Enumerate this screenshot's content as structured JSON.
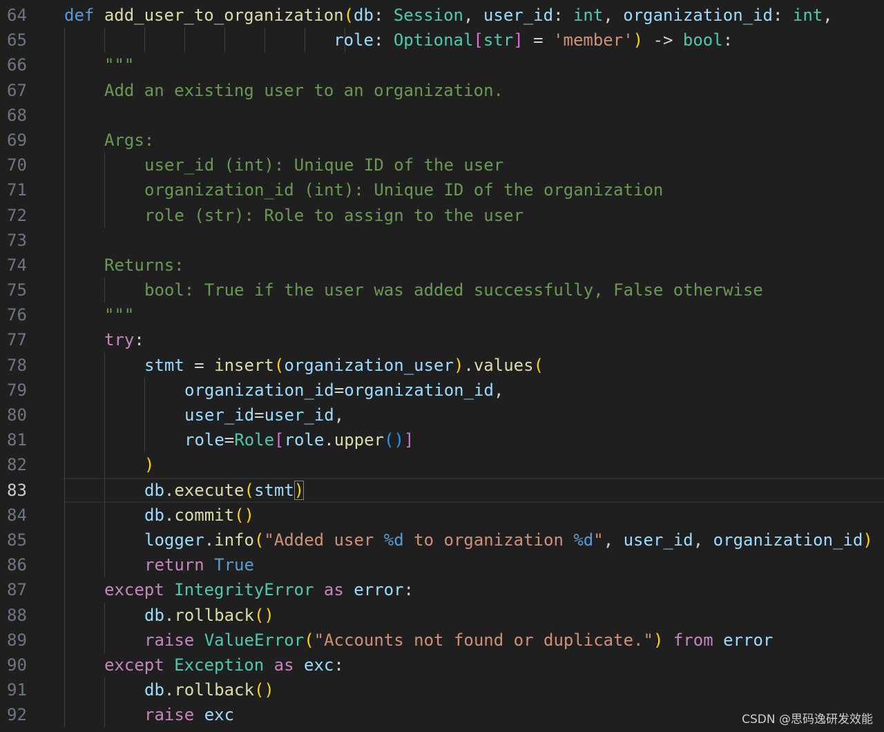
{
  "editor": {
    "current_line": 83,
    "lines": [
      {
        "n": 64,
        "indent": 0,
        "tokens": [
          [
            "kw",
            "def"
          ],
          [
            "op",
            " "
          ],
          [
            "fn",
            "add_user_to_organization"
          ],
          [
            "b1",
            "("
          ],
          [
            "var",
            "db"
          ],
          [
            "op",
            ": "
          ],
          [
            "type",
            "Session"
          ],
          [
            "op",
            ", "
          ],
          [
            "var",
            "user_id"
          ],
          [
            "op",
            ": "
          ],
          [
            "type",
            "int"
          ],
          [
            "op",
            ", "
          ],
          [
            "var",
            "organization_id"
          ],
          [
            "op",
            ": "
          ],
          [
            "type",
            "int"
          ],
          [
            "op",
            ","
          ]
        ]
      },
      {
        "n": 65,
        "indent": 0,
        "tokens": [
          [
            "op",
            "                           "
          ],
          [
            "var",
            "role"
          ],
          [
            "op",
            ": "
          ],
          [
            "type",
            "Optional"
          ],
          [
            "b2",
            "["
          ],
          [
            "type",
            "str"
          ],
          [
            "b2",
            "]"
          ],
          [
            "op",
            " = "
          ],
          [
            "str",
            "'member'"
          ],
          [
            "b1",
            ")"
          ],
          [
            "op",
            " -> "
          ],
          [
            "type",
            "bool"
          ],
          [
            "op",
            ":"
          ]
        ]
      },
      {
        "n": 66,
        "indent": 1,
        "tokens": [
          [
            "doc",
            "\"\"\""
          ]
        ]
      },
      {
        "n": 67,
        "indent": 1,
        "tokens": [
          [
            "doc",
            "Add an existing user to an organization."
          ]
        ]
      },
      {
        "n": 68,
        "indent": 1,
        "tokens": []
      },
      {
        "n": 69,
        "indent": 1,
        "tokens": [
          [
            "doc",
            "Args:"
          ]
        ]
      },
      {
        "n": 70,
        "indent": 2,
        "tokens": [
          [
            "doc",
            "user_id (int): Unique ID of the user"
          ]
        ]
      },
      {
        "n": 71,
        "indent": 2,
        "tokens": [
          [
            "doc",
            "organization_id (int): Unique ID of the organization"
          ]
        ]
      },
      {
        "n": 72,
        "indent": 2,
        "tokens": [
          [
            "doc",
            "role (str): Role to assign to the user"
          ]
        ]
      },
      {
        "n": 73,
        "indent": 1,
        "tokens": []
      },
      {
        "n": 74,
        "indent": 1,
        "tokens": [
          [
            "doc",
            "Returns:"
          ]
        ]
      },
      {
        "n": 75,
        "indent": 2,
        "tokens": [
          [
            "doc",
            "bool: True if the user was added successfully, False otherwise"
          ]
        ]
      },
      {
        "n": 76,
        "indent": 1,
        "tokens": [
          [
            "doc",
            "\"\"\""
          ]
        ]
      },
      {
        "n": 77,
        "indent": 1,
        "tokens": [
          [
            "ctrl",
            "try"
          ],
          [
            "op",
            ":"
          ]
        ]
      },
      {
        "n": 78,
        "indent": 2,
        "tokens": [
          [
            "var",
            "stmt"
          ],
          [
            "op",
            " = "
          ],
          [
            "fn",
            "insert"
          ],
          [
            "b1",
            "("
          ],
          [
            "var",
            "organization_user"
          ],
          [
            "b1",
            ")"
          ],
          [
            "op",
            "."
          ],
          [
            "fn",
            "values"
          ],
          [
            "b1",
            "("
          ]
        ]
      },
      {
        "n": 79,
        "indent": 3,
        "tokens": [
          [
            "var",
            "organization_id"
          ],
          [
            "op",
            "="
          ],
          [
            "var",
            "organization_id"
          ],
          [
            "op",
            ","
          ]
        ]
      },
      {
        "n": 80,
        "indent": 3,
        "tokens": [
          [
            "var",
            "user_id"
          ],
          [
            "op",
            "="
          ],
          [
            "var",
            "user_id"
          ],
          [
            "op",
            ","
          ]
        ]
      },
      {
        "n": 81,
        "indent": 3,
        "tokens": [
          [
            "var",
            "role"
          ],
          [
            "op",
            "="
          ],
          [
            "type",
            "Role"
          ],
          [
            "b2",
            "["
          ],
          [
            "var",
            "role"
          ],
          [
            "op",
            "."
          ],
          [
            "fn",
            "upper"
          ],
          [
            "b3",
            "()"
          ],
          [
            "b2",
            "]"
          ]
        ]
      },
      {
        "n": 82,
        "indent": 2,
        "tokens": [
          [
            "b1",
            ")"
          ]
        ]
      },
      {
        "n": 83,
        "indent": 2,
        "tokens": [
          [
            "var",
            "db"
          ],
          [
            "op",
            "."
          ],
          [
            "fn",
            "execute"
          ],
          [
            "b1",
            "("
          ],
          [
            "var",
            "stmt"
          ],
          [
            "b1m",
            ")"
          ]
        ]
      },
      {
        "n": 84,
        "indent": 2,
        "tokens": [
          [
            "var",
            "db"
          ],
          [
            "op",
            "."
          ],
          [
            "fn",
            "commit"
          ],
          [
            "b1",
            "()"
          ]
        ]
      },
      {
        "n": 85,
        "indent": 2,
        "tokens": [
          [
            "var",
            "logger"
          ],
          [
            "op",
            "."
          ],
          [
            "fn",
            "info"
          ],
          [
            "b1",
            "("
          ],
          [
            "str",
            "\"Added user "
          ],
          [
            "fmt",
            "%d"
          ],
          [
            "str",
            " to organization "
          ],
          [
            "fmt",
            "%d"
          ],
          [
            "str",
            "\""
          ],
          [
            "op",
            ", "
          ],
          [
            "var",
            "user_id"
          ],
          [
            "op",
            ", "
          ],
          [
            "var",
            "organization_id"
          ],
          [
            "b1",
            ")"
          ]
        ]
      },
      {
        "n": 86,
        "indent": 2,
        "tokens": [
          [
            "ctrl",
            "return"
          ],
          [
            "op",
            " "
          ],
          [
            "kw",
            "True"
          ]
        ]
      },
      {
        "n": 87,
        "indent": 1,
        "tokens": [
          [
            "ctrl",
            "except"
          ],
          [
            "op",
            " "
          ],
          [
            "type",
            "IntegrityError"
          ],
          [
            "op",
            " "
          ],
          [
            "ctrl",
            "as"
          ],
          [
            "op",
            " "
          ],
          [
            "var",
            "error"
          ],
          [
            "op",
            ":"
          ]
        ]
      },
      {
        "n": 88,
        "indent": 2,
        "tokens": [
          [
            "var",
            "db"
          ],
          [
            "op",
            "."
          ],
          [
            "fn",
            "rollback"
          ],
          [
            "b1",
            "()"
          ]
        ]
      },
      {
        "n": 89,
        "indent": 2,
        "tokens": [
          [
            "ctrl",
            "raise"
          ],
          [
            "op",
            " "
          ],
          [
            "type",
            "ValueError"
          ],
          [
            "b1",
            "("
          ],
          [
            "str",
            "\"Accounts not found or duplicate.\""
          ],
          [
            "b1",
            ")"
          ],
          [
            "op",
            " "
          ],
          [
            "ctrl",
            "from"
          ],
          [
            "op",
            " "
          ],
          [
            "var",
            "error"
          ]
        ]
      },
      {
        "n": 90,
        "indent": 1,
        "tokens": [
          [
            "ctrl",
            "except"
          ],
          [
            "op",
            " "
          ],
          [
            "type",
            "Exception"
          ],
          [
            "op",
            " "
          ],
          [
            "ctrl",
            "as"
          ],
          [
            "op",
            " "
          ],
          [
            "var",
            "exc"
          ],
          [
            "op",
            ":"
          ]
        ]
      },
      {
        "n": 91,
        "indent": 2,
        "tokens": [
          [
            "var",
            "db"
          ],
          [
            "op",
            "."
          ],
          [
            "fn",
            "rollback"
          ],
          [
            "b1",
            "()"
          ]
        ]
      },
      {
        "n": 92,
        "indent": 2,
        "tokens": [
          [
            "ctrl",
            "raise"
          ],
          [
            "op",
            " "
          ],
          [
            "var",
            "exc"
          ]
        ]
      }
    ]
  },
  "watermark": "CSDN @思码逸研发效能"
}
